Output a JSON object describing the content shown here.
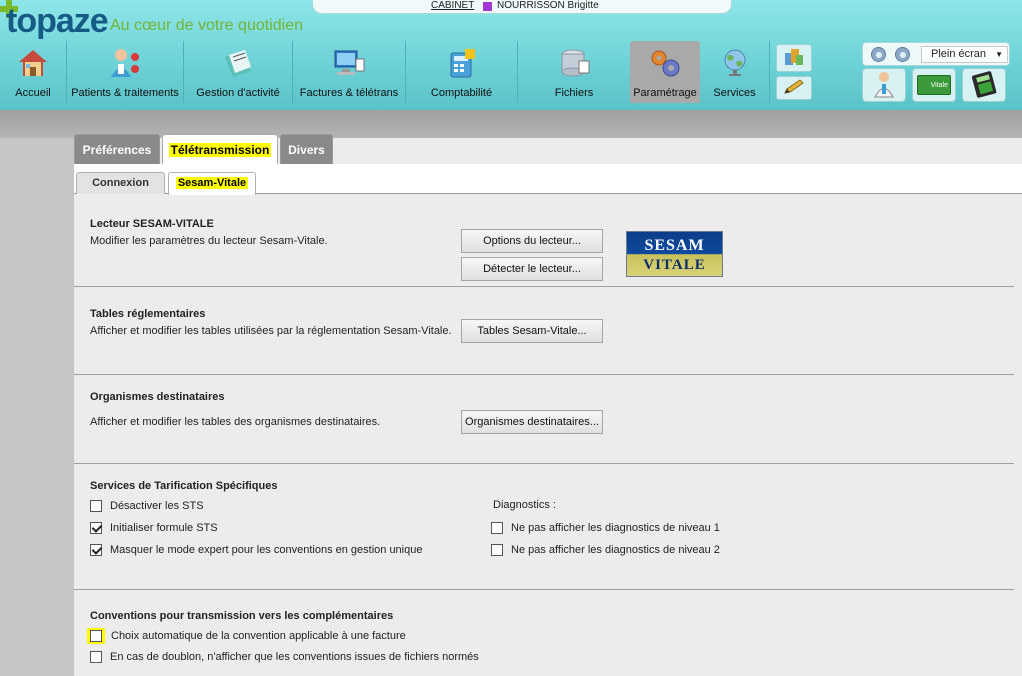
{
  "app": {
    "logo": "topaze",
    "tagline": "Au cœur de votre quotidien"
  },
  "userbar": {
    "cabinet": "CABINET",
    "user": "NOURRISSON Brigitte",
    "user_color": "#a334d6"
  },
  "nav": [
    {
      "label": "Accueil",
      "icon": "house-icon"
    },
    {
      "label": "Patients & traitements",
      "icon": "patients-icon"
    },
    {
      "label": "Gestion d'activité",
      "icon": "folder-icon"
    },
    {
      "label": "Factures & télétrans",
      "icon": "computer-icon"
    },
    {
      "label": "Comptabilité",
      "icon": "calculator-icon"
    },
    {
      "label": "Fichiers",
      "icon": "database-icon"
    },
    {
      "label": "Paramétrage",
      "icon": "gears-icon"
    },
    {
      "label": "Services",
      "icon": "globe-icon"
    }
  ],
  "right_panel": {
    "fullscreen": "Plein écran",
    "vitale_label": "Vitale"
  },
  "tabs": [
    "Préférences",
    "Télétransmission",
    "Divers"
  ],
  "subtabs": [
    "Connexion",
    "Sesam-Vitale"
  ],
  "sections": {
    "reader": {
      "title": "Lecteur SESAM-VITALE",
      "desc": "Modifier les paramètres du lecteur Sesam-Vitale.",
      "btn_options": "Options du lecteur...",
      "btn_detect": "Détecter le lecteur...",
      "logo_top": "SESAM",
      "logo_bottom": "VITALE"
    },
    "tables": {
      "title": "Tables réglementaires",
      "desc": "Afficher et modifier les tables utilisées par la réglementation Sesam-Vitale.",
      "btn": "Tables Sesam-Vitale..."
    },
    "orgs": {
      "title": "Organismes destinataires",
      "desc": "Afficher et modifier les tables des organismes destinataires.",
      "btn": "Organismes destinataires..."
    },
    "sts": {
      "title": "Services de Tarification Spécifiques",
      "opt1": "Désactiver les STS",
      "opt2": "Initialiser formule STS",
      "opt3": "Masquer le mode expert pour les conventions en gestion unique",
      "diag_title": "Diagnostics :",
      "diag1": "Ne pas afficher les diagnostics de niveau 1",
      "diag2": "Ne pas afficher les diagnostics de niveau 2"
    },
    "conventions": {
      "title": "Conventions pour transmission vers les complémentaires",
      "opt1": "Choix automatique de la convention applicable à une facture",
      "opt2": "En cas de doublon, n'afficher que les conventions issues de fichiers normés"
    }
  },
  "colors": {
    "accent": "#6fd3d8",
    "highlight": "#ffff00",
    "logo_green": "#75b534",
    "logo_blue": "#165a86"
  }
}
